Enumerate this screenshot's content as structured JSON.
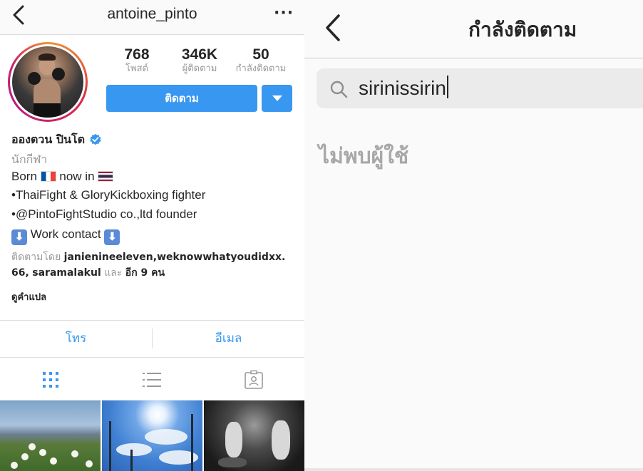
{
  "profile_screen": {
    "nav": {
      "username": "antoine_pinto",
      "back_icon": "chevron-left-icon",
      "more_icon": "ellipsis-icon",
      "more_label": "···"
    },
    "stats": [
      {
        "value": "768",
        "label": "โพสต์"
      },
      {
        "value": "346K",
        "label": "ผู้ติดตาม"
      },
      {
        "value": "50",
        "label": "กำลังติดตาม"
      }
    ],
    "follow_button_label": "ติดตาม",
    "full_name": "อองตวน ปินโต",
    "verified_icon": "verified-badge-icon",
    "category": "นักกีฬา",
    "bio": {
      "line1_born": "Born",
      "line1_now_in": "now in",
      "line2": "•ThaiFight & GloryKickboxing fighter",
      "line3": "•@PintoFightStudio co.,ltd founder",
      "line4": "Work contact",
      "down_arrow_glyph": "⬇"
    },
    "followed_by": {
      "prefix": "ติดตามโดย",
      "user1": "janienineeleven",
      "user2": "weknowwhatyoudidxx.",
      "user3_cont": "66",
      "user4": "saramalakul",
      "and_label": "และ",
      "others": "อีก 9 คน"
    },
    "translate_label": "ดูคำแปล",
    "contact": {
      "call_label": "โทร",
      "email_label": "อีเมล"
    },
    "tabs": [
      {
        "icon": "grid-icon",
        "active": true
      },
      {
        "icon": "list-icon",
        "active": false
      },
      {
        "icon": "tagged-icon",
        "active": false
      }
    ],
    "colors": {
      "accent_blue": "#3897f0",
      "text_dark": "#262626",
      "text_gray": "#999999"
    }
  },
  "following_screen": {
    "title": "กำลังติดตาม",
    "back_icon": "chevron-left-icon",
    "search_icon": "search-icon",
    "search_value": "sirinissirin",
    "empty_message": "ไม่พบผู้ใช้"
  }
}
